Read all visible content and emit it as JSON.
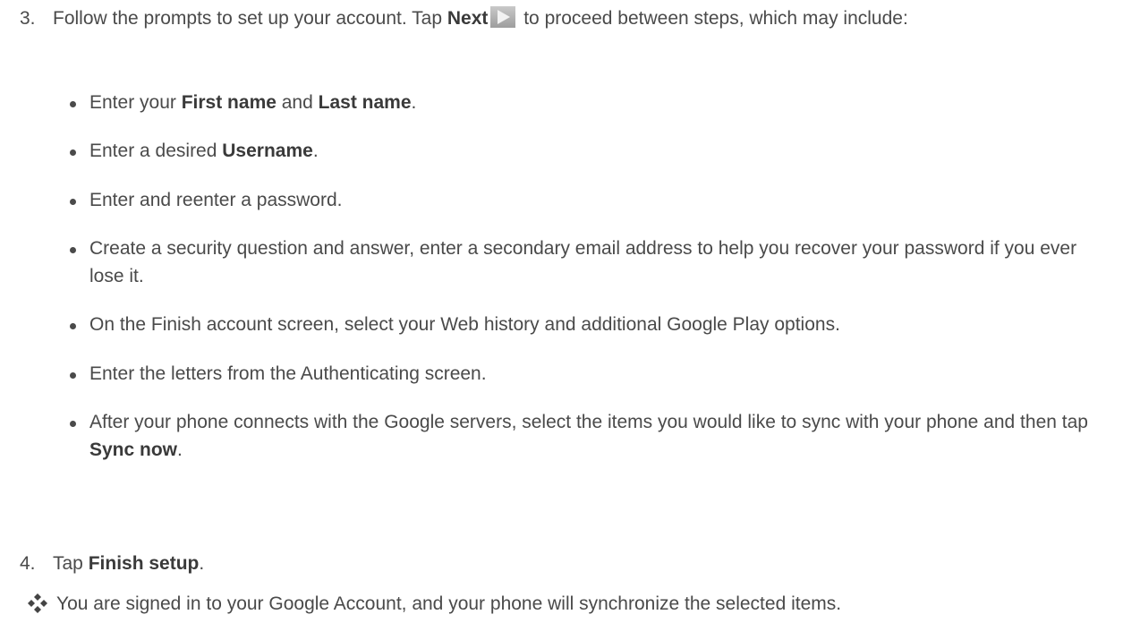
{
  "step3": {
    "number": "3.",
    "text_before": "Follow the prompts to set up your account. Tap ",
    "next_label": "Next",
    "text_after": " to proceed between steps, which may include:",
    "next_icon": "next-arrow-icon"
  },
  "bullets": [
    {
      "t1": "Enter your ",
      "b1": "First name",
      "t2": " and ",
      "b2": "Last name",
      "t3": "."
    },
    {
      "t1": "Enter a desired ",
      "b1": "Username",
      "t2": ".",
      "b2": "",
      "t3": ""
    },
    {
      "t1": "Enter and reenter a password.",
      "b1": "",
      "t2": "",
      "b2": "",
      "t3": ""
    },
    {
      "t1": "Create a security question and answer, enter a secondary email address to help you recover your password if you ever lose it.",
      "b1": "",
      "t2": "",
      "b2": "",
      "t3": ""
    },
    {
      "t1": "On the Finish account screen, select your Web history and additional Google Play options.",
      "b1": "",
      "t2": "",
      "b2": "",
      "t3": ""
    },
    {
      "t1": "Enter the letters from the Authenticating screen.",
      "b1": "",
      "t2": "",
      "b2": "",
      "t3": ""
    },
    {
      "t1": "After your phone connects with the Google servers, select the items you would like to sync with your phone and then tap ",
      "b1": "Sync now",
      "t2": ".",
      "b2": "",
      "t3": ""
    }
  ],
  "step4": {
    "number": "4.",
    "text_before": "Tap ",
    "bold": "Finish setup",
    "text_after": "."
  },
  "result": {
    "icon": "four-diamonds-result-icon",
    "text": "You are signed in to your Google Account, and your phone will synchronize the selected items."
  },
  "colors": {
    "text": "#4a4a4a",
    "icon": "#444444"
  }
}
